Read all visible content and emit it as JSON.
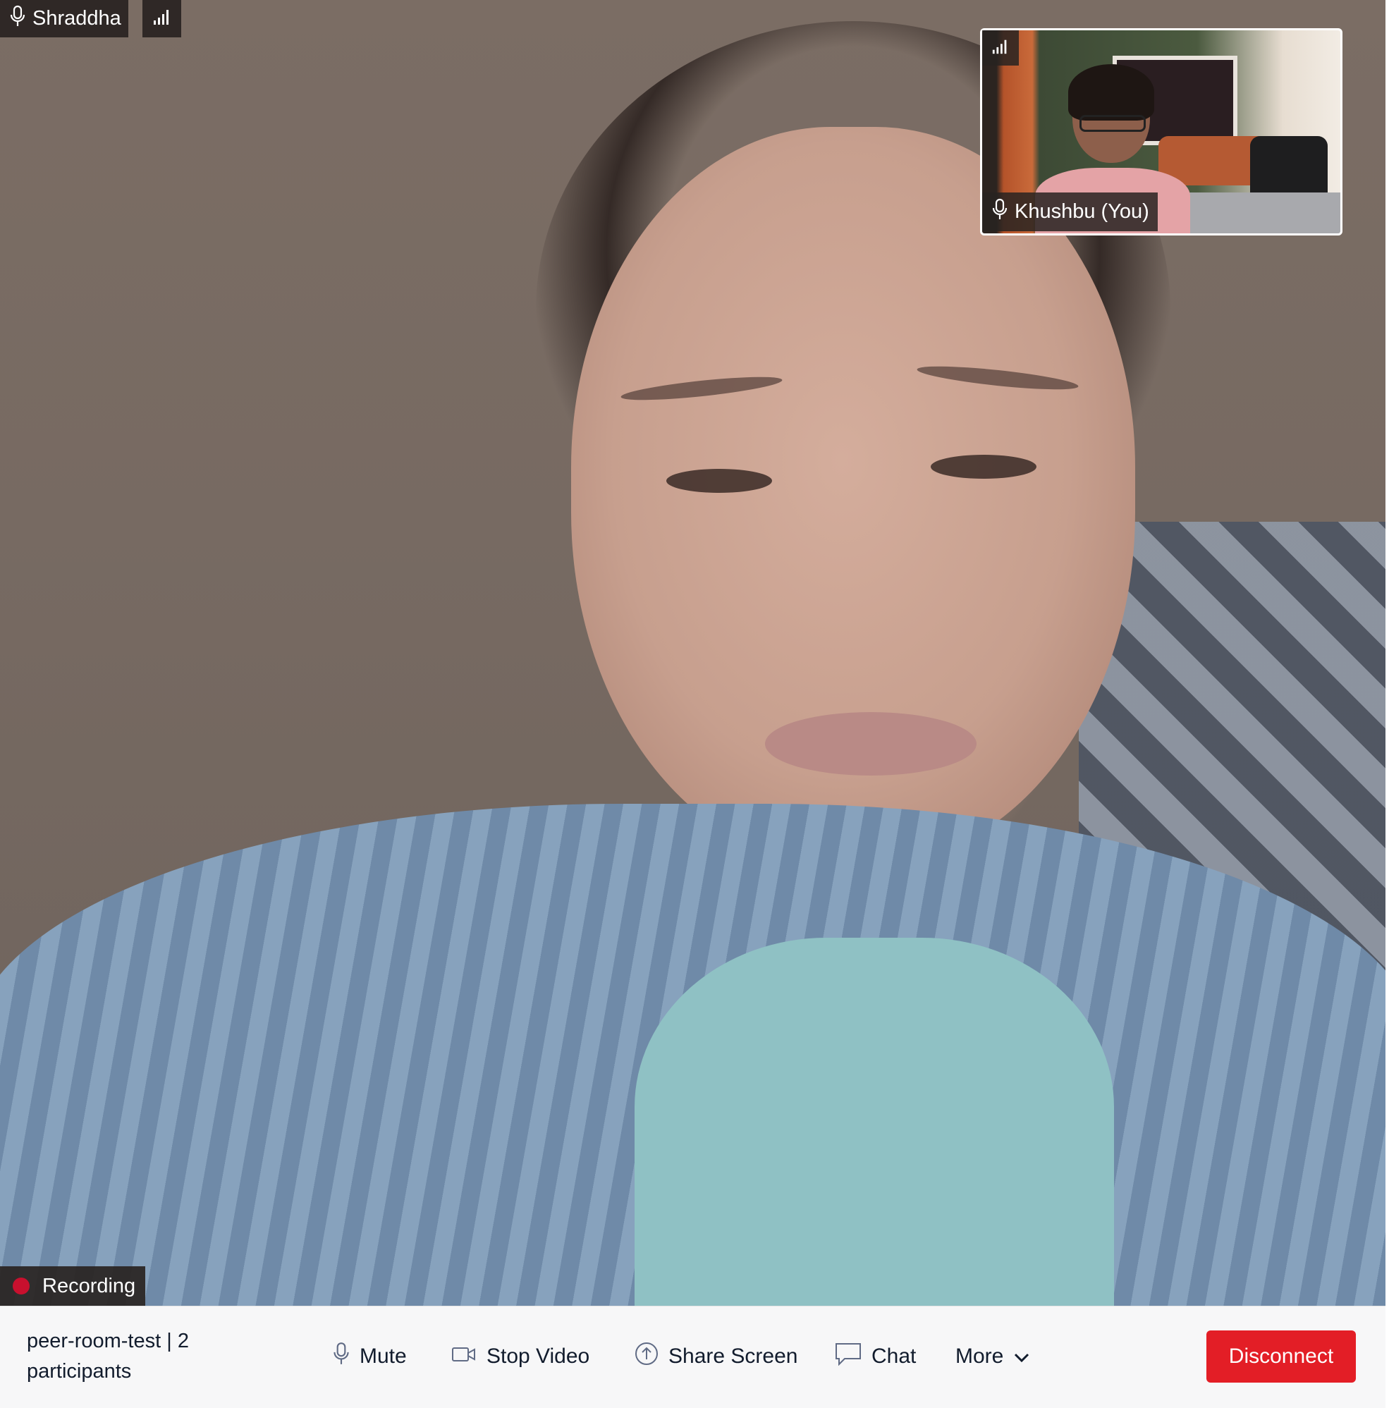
{
  "main_participant": {
    "name": "Shraddha",
    "mic_icon": "microphone-icon",
    "signal_icon": "network-signal-icon"
  },
  "recording": {
    "label": "Recording",
    "dot_color": "#c8102e"
  },
  "self_view": {
    "name": "Khushbu (You)",
    "mic_icon": "microphone-icon",
    "signal_icon": "network-signal-icon"
  },
  "control_bar": {
    "room_name": "peer-room-test",
    "separator": "|",
    "participant_count": "2",
    "participants_word": "participants",
    "mute_label": "Mute",
    "stop_video_label": "Stop Video",
    "share_screen_label": "Share Screen",
    "chat_label": "Chat",
    "more_label": "More",
    "disconnect_label": "Disconnect"
  },
  "colors": {
    "disconnect": "#e31e26",
    "bar_background": "#f7f7f8",
    "text": "#121c2d",
    "overlay": "#28231f"
  }
}
